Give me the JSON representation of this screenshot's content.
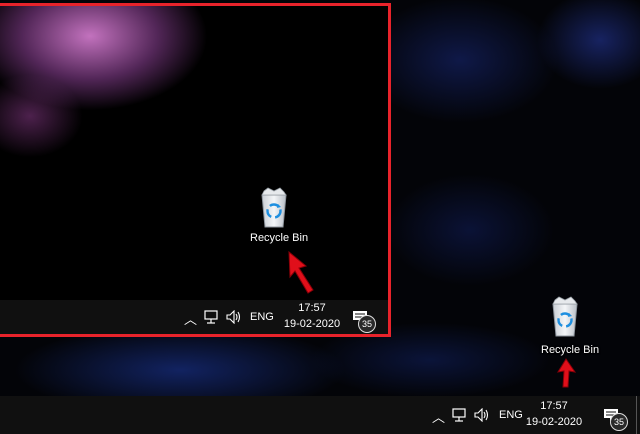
{
  "desktop": {
    "recycle_bin_label": "Recycle Bin"
  },
  "inset": {
    "recycle_bin_label": "Recycle Bin",
    "taskbar": {
      "language": "ENG",
      "time": "17:57",
      "date": "19-02-2020",
      "notification_count": "35"
    }
  },
  "taskbar": {
    "language": "ENG",
    "time": "17:57",
    "date": "19-02-2020",
    "notification_count": "35"
  },
  "colors": {
    "highlight_border": "#e8232b",
    "arrow": "#e00f1a",
    "taskbar_bg": "#101010",
    "recycle_symbol": "#1e8fe0"
  },
  "icons": {
    "recycle_bin": "recycle-bin-icon",
    "show_hidden": "chevron-up-icon",
    "network": "network-icon",
    "volume": "volume-icon",
    "notifications": "action-center-icon",
    "annotation": "red-arrow"
  }
}
